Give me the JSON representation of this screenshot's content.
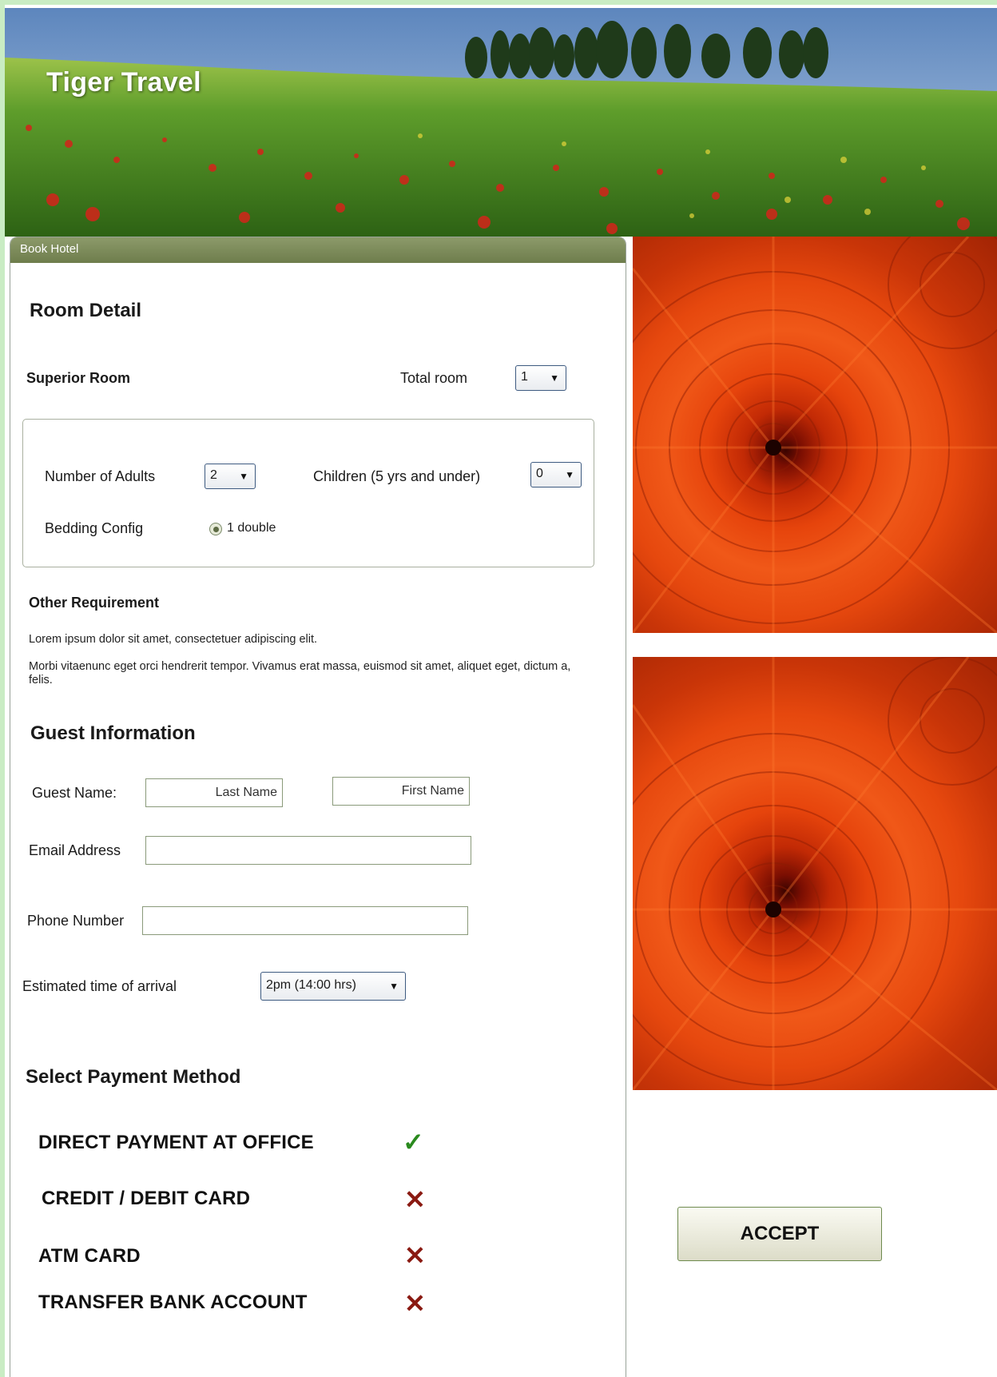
{
  "app": {
    "title": "Tiger Travel"
  },
  "panel": {
    "header": "Book Hotel"
  },
  "room_detail": {
    "heading": "Room Detail",
    "room_type": "Superior Room",
    "total_room_label": "Total room",
    "total_room_value": "1",
    "adults_label": "Number of Adults",
    "adults_value": "2",
    "children_label": "Children (5 yrs and under)",
    "children_value": "0",
    "bedding_label": "Bedding Config",
    "bedding_option": "1 double"
  },
  "other_requirement": {
    "heading": "Other Requirement",
    "line1": "Lorem ipsum dolor sit amet, consectetuer adipiscing elit.",
    "line2": "Morbi vitaenunc eget orci hendrerit tempor. Vivamus erat massa, euismod sit amet, aliquet eget, dictum a, felis."
  },
  "guest_information": {
    "heading": "Guest Information",
    "name_label": "Guest Name:",
    "last_name_value": "Last Name",
    "first_name_value": "First Name",
    "email_label": "Email Address",
    "email_value": "",
    "phone_label": "Phone Number",
    "phone_value": "",
    "arrival_label": "Estimated time of arrival",
    "arrival_value": "2pm  (14:00 hrs)"
  },
  "payment": {
    "heading": "Select Payment Method",
    "methods": [
      {
        "label": "DIRECT PAYMENT AT OFFICE",
        "mark": "check-icon",
        "glyph": "✓"
      },
      {
        "label": "CREDIT / DEBIT CARD",
        "mark": "cross-icon",
        "glyph": "✕"
      },
      {
        "label": "ATM CARD",
        "mark": "cross-icon",
        "glyph": "✕"
      },
      {
        "label": "TRANSFER BANK ACCOUNT",
        "mark": "cross-icon",
        "glyph": "✕"
      }
    ]
  },
  "accept_label": "ACCEPT",
  "colors": {
    "panel_header": "#7a884f",
    "check": "#2a8a1e",
    "cross": "#8a1a12",
    "frame": "#c9ecc3"
  },
  "icons": {
    "dropdown": "chevron-down-icon",
    "banner": "landscape-image",
    "side_images": "flower-image"
  }
}
